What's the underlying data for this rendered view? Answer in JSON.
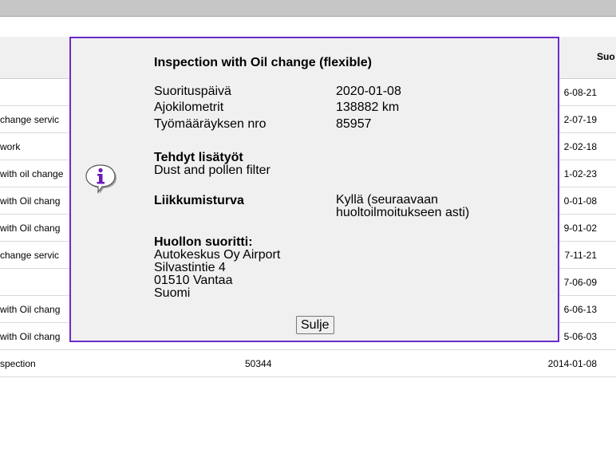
{
  "table": {
    "header_partial": "Suo",
    "rows": [
      {
        "desc": "",
        "order": "",
        "date": "6-08-21"
      },
      {
        "desc": "change servic",
        "order": "",
        "date": "2-07-19"
      },
      {
        "desc": "work",
        "order": "",
        "date": "2-02-18"
      },
      {
        "desc": "with oil change",
        "order": "",
        "date": "1-02-23"
      },
      {
        "desc": "with Oil chang",
        "order": "",
        "date": "0-01-08"
      },
      {
        "desc": "with Oil chang",
        "order": "",
        "date": "9-01-02"
      },
      {
        "desc": "change servic",
        "order": "",
        "date": "7-11-21"
      },
      {
        "desc": "",
        "order": "",
        "date": "7-06-09"
      },
      {
        "desc": "with Oil chang",
        "order": "",
        "date": "6-06-13"
      },
      {
        "desc": "with Oil chang",
        "order": "",
        "date": "5-06-03"
      },
      {
        "desc": "spection",
        "order": "50344",
        "date": "2014-01-08"
      }
    ]
  },
  "modal": {
    "title": "Inspection with Oil change (flexible)",
    "fields": {
      "date_label": "Suorituspäivä",
      "date_value": "2020-01-08",
      "km_label": "Ajokilometrit",
      "km_value": "138882 km",
      "order_label": "Työmääräyksen nro",
      "order_value": "85957"
    },
    "extra_work_title": "Tehdyt lisätyöt",
    "extra_work_value": "Dust and pollen filter",
    "mobility_title": "Liikkumisturva",
    "mobility_value_line1": "Kyllä (seuraavaan",
    "mobility_value_line2": "huoltoilmoitukseen asti)",
    "service_by_title": "Huollon suoritti:",
    "service_by_lines": [
      "Autokeskus Oy Airport",
      "Silvastintie 4",
      "01510 Vantaa",
      "Suomi"
    ],
    "close_label": "Sulje",
    "icon": "info-icon"
  },
  "colors": {
    "modal_border": "#6a2bc9",
    "icon_letter": "#6a1bbf"
  }
}
